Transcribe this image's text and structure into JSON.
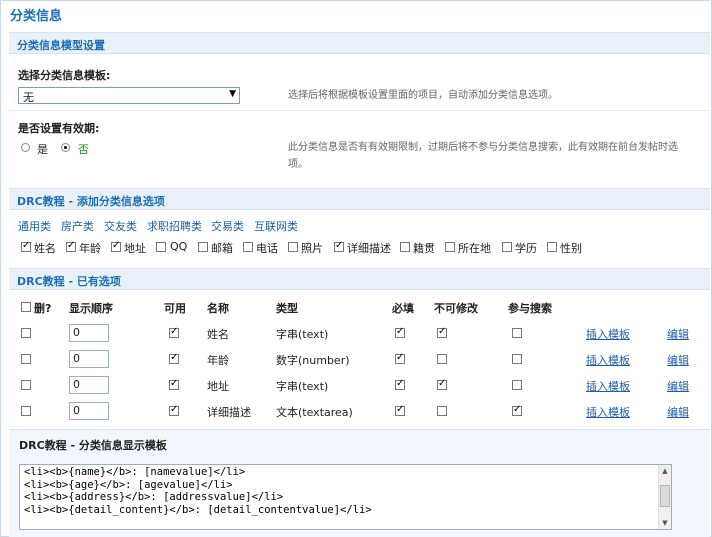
{
  "page": {
    "title": "分类信息"
  },
  "model_settings": {
    "section_title": "分类信息模型设置",
    "template_label": "选择分类信息模板:",
    "template_selected": "无",
    "template_hint": "选择后将根据模板设置里面的项目，自动添加分类信息选项。",
    "expiry_label": "是否设置有效期:",
    "expiry_yes": "是",
    "expiry_no": "否",
    "expiry_selected": "否",
    "expiry_hint_line1": "此分类信息是否有有效期限制，过期后将不参与分类信息搜索，此有效期在前台发帖时选",
    "expiry_hint_line2": "项。"
  },
  "add_options": {
    "section_title": "DRC教程 - 添加分类信息选项",
    "categories": [
      "通用类",
      "房产类",
      "交友类",
      "求职招聘类",
      "交易类",
      "互联网类"
    ],
    "fields": [
      {
        "label": "姓名",
        "checked": true
      },
      {
        "label": "年龄",
        "checked": true
      },
      {
        "label": "地址",
        "checked": true
      },
      {
        "label": "QQ",
        "checked": false
      },
      {
        "label": "邮箱",
        "checked": false
      },
      {
        "label": "电话",
        "checked": false
      },
      {
        "label": "照片",
        "checked": false
      },
      {
        "label": "详细描述",
        "checked": true
      },
      {
        "label": "籍贯",
        "checked": false
      },
      {
        "label": "所在地",
        "checked": false
      },
      {
        "label": "学历",
        "checked": false
      },
      {
        "label": "性别",
        "checked": false
      }
    ]
  },
  "existing_options": {
    "section_title": "DRC教程 - 已有选项",
    "headers": {
      "delete": "删?",
      "order": "显示顺序",
      "enabled": "可用",
      "name": "名称",
      "type": "类型",
      "required": "必填",
      "readonly": "不可修改",
      "search": "参与搜索"
    },
    "insert_label": "插入模板",
    "edit_label": "编辑",
    "rows": [
      {
        "order": "0",
        "enabled": true,
        "name": "姓名",
        "type": "字串(text)",
        "required": true,
        "readonly": true,
        "search": false
      },
      {
        "order": "0",
        "enabled": true,
        "name": "年龄",
        "type": "数字(number)",
        "required": true,
        "readonly": false,
        "search": false
      },
      {
        "order": "0",
        "enabled": true,
        "name": "地址",
        "type": "字串(text)",
        "required": true,
        "readonly": true,
        "search": false
      },
      {
        "order": "0",
        "enabled": true,
        "name": "详细描述",
        "type": "文本(textarea)",
        "required": true,
        "readonly": false,
        "search": true
      }
    ]
  },
  "display_template": {
    "section_title": "DRC教程 - 分类信息显示模板",
    "lines": [
      "<li><b>{name}</b>: [namevalue]</li>",
      "<li><b>{age}</b>: [agevalue]</li>",
      "<li><b>{address}</b>: [addressvalue]</li>",
      "<li><b>{detail_content}</b>: [detail_contentvalue]</li>"
    ]
  }
}
